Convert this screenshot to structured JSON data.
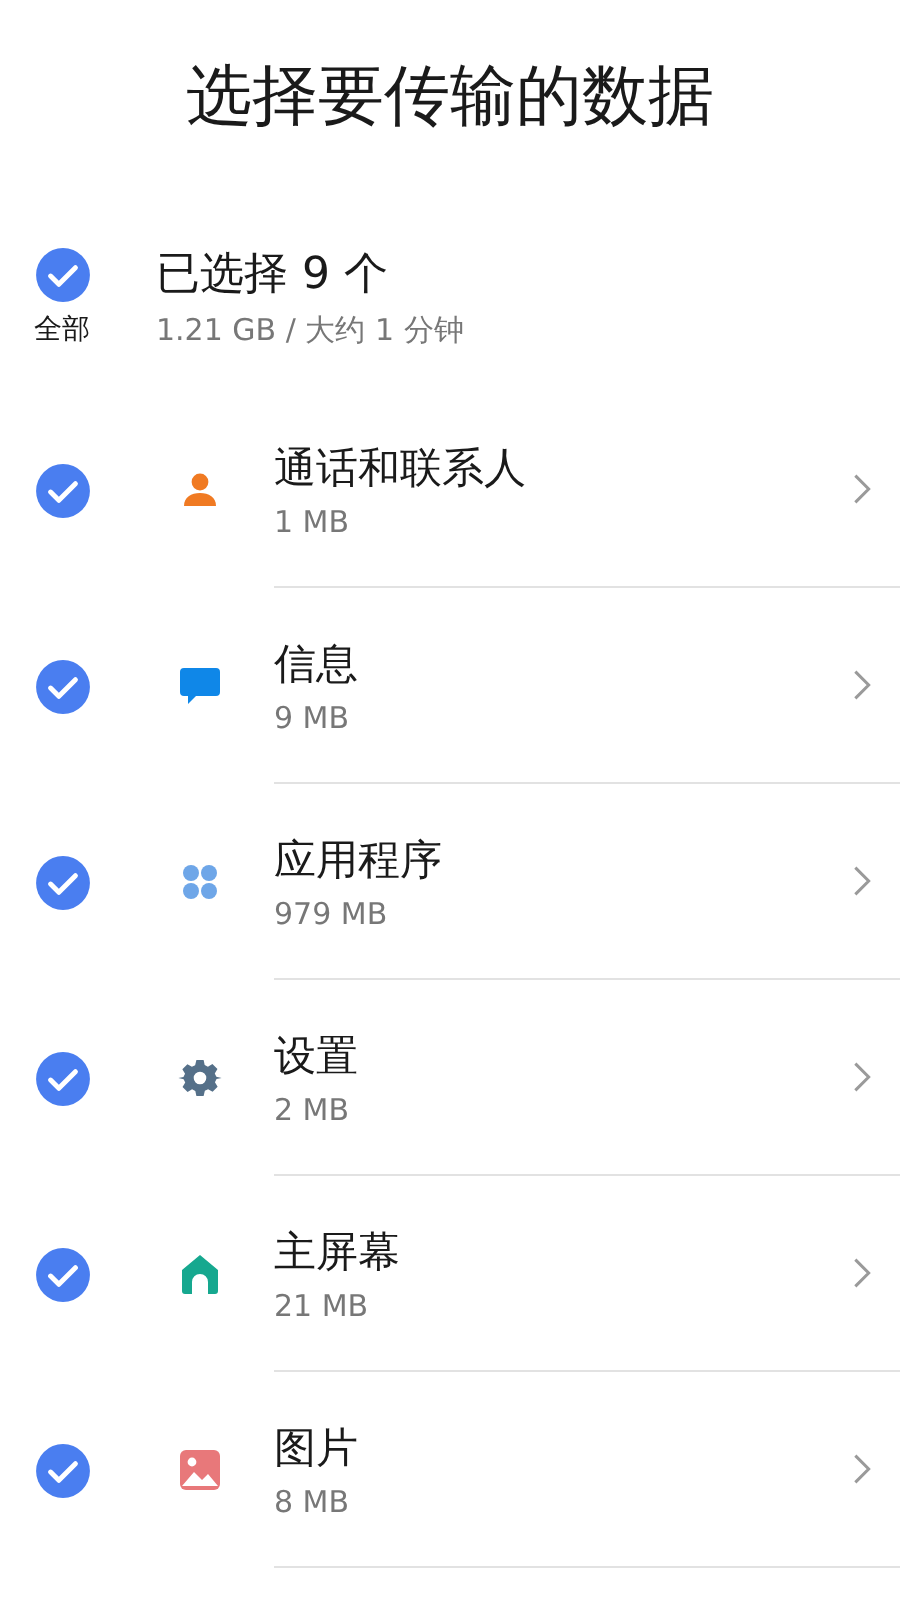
{
  "title": "选择要传输的数据",
  "select_all": {
    "checked": true,
    "label": "全部",
    "summary": "已选择 9 个",
    "detail": "1.21 GB / 大约 1 分钟"
  },
  "items": [
    {
      "kind": "contacts",
      "name": "通话和联系人",
      "size": "1 MB",
      "checked": true
    },
    {
      "kind": "messages",
      "name": "信息",
      "size": "9 MB",
      "checked": true
    },
    {
      "kind": "apps",
      "name": "应用程序",
      "size": "979 MB",
      "checked": true
    },
    {
      "kind": "settings",
      "name": "设置",
      "size": "2 MB",
      "checked": true
    },
    {
      "kind": "home",
      "name": "主屏幕",
      "size": "21 MB",
      "checked": true
    },
    {
      "kind": "pictures",
      "name": "图片",
      "size": "8 MB",
      "checked": true
    }
  ]
}
